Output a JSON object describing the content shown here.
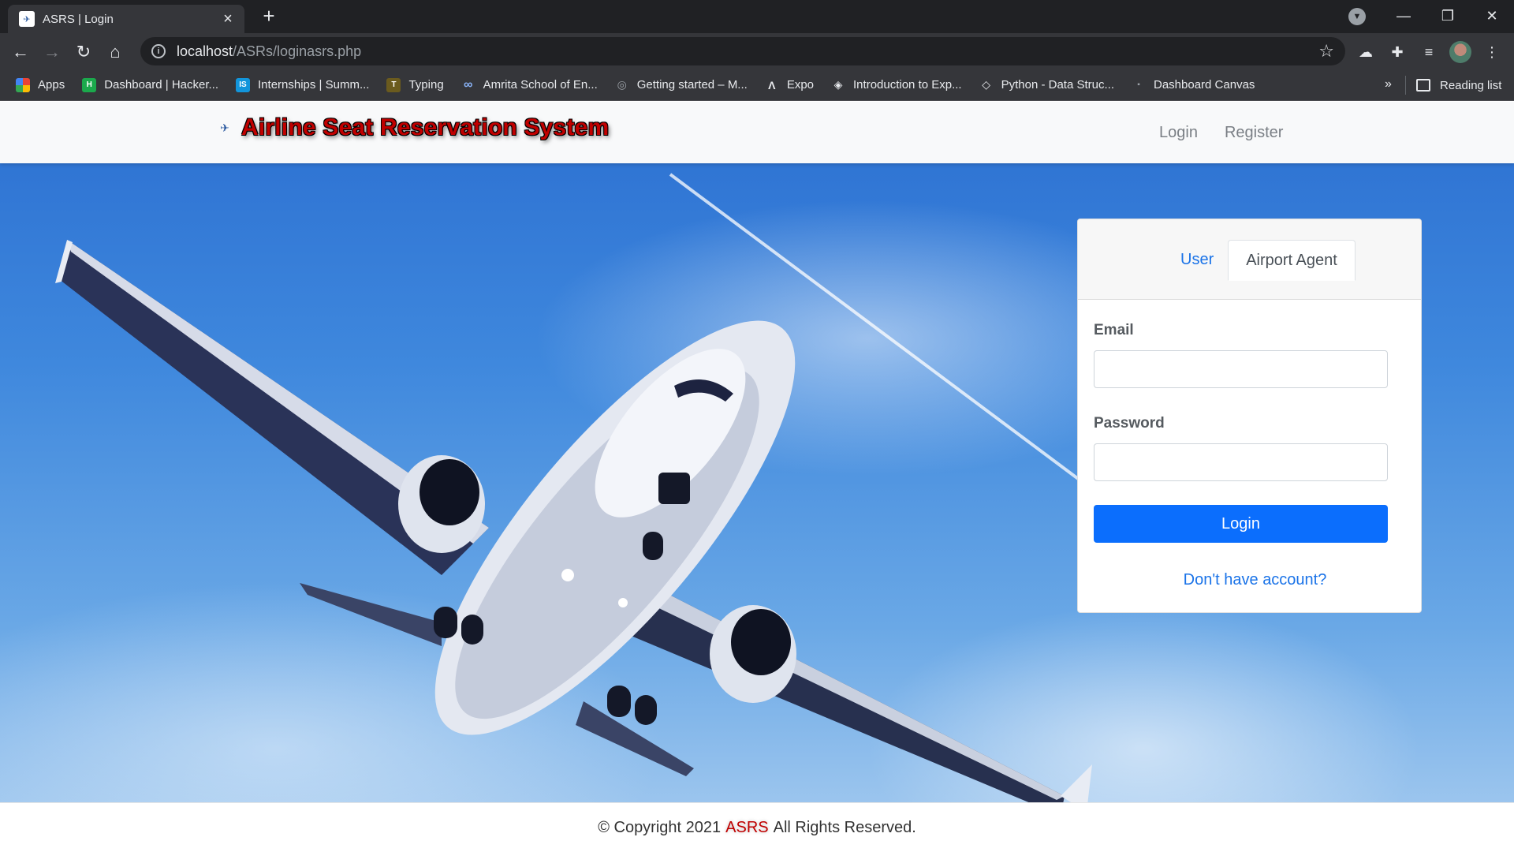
{
  "browser": {
    "tab_title": "ASRS | Login",
    "url_host": "localhost",
    "url_path": "/ASRs/loginasrs.php",
    "bookmarks": [
      {
        "label": "Apps",
        "icon": "apps-grid-icon",
        "color": "#ea4335"
      },
      {
        "label": "Dashboard | Hacker...",
        "icon": "hackerrank-icon",
        "color": "#1ba94c"
      },
      {
        "label": "Internships | Summ...",
        "icon": "internshala-icon",
        "color": "#1295db"
      },
      {
        "label": "Typing",
        "icon": "typing-icon",
        "color": "#c9a227"
      },
      {
        "label": "Amrita School of En...",
        "icon": "infinity-icon",
        "color": "#8ab4f8"
      },
      {
        "label": "Getting started – M...",
        "icon": "globe-icon",
        "color": "#9aa0a6"
      },
      {
        "label": "Expo",
        "icon": "expo-icon",
        "color": "#e8eaed"
      },
      {
        "label": "Introduction to Exp...",
        "icon": "course-icon",
        "color": "#e8eaed"
      },
      {
        "label": "Python - Data Struc...",
        "icon": "python-icon",
        "color": "#e8eaed"
      },
      {
        "label": "Dashboard Canvas",
        "icon": "canvas-icon",
        "color": "#9aa0a6"
      }
    ],
    "more_bookmarks": "»",
    "reading_list": "Reading list"
  },
  "navbar": {
    "brand": "Airline Seat Reservation System",
    "links": [
      "Login",
      "Register"
    ]
  },
  "login": {
    "tabs": [
      "User",
      "Airport Agent"
    ],
    "email_label": "Email",
    "password_label": "Password",
    "button": "Login",
    "signup_link": "Don't have account?"
  },
  "footer": {
    "prefix": "© Copyright 2021",
    "brand": "ASRS",
    "suffix": "All Rights Reserved."
  },
  "colors": {
    "brand_red": "#c00000",
    "primary_blue": "#0b6efd",
    "sky_blue": "#3f88dd"
  }
}
